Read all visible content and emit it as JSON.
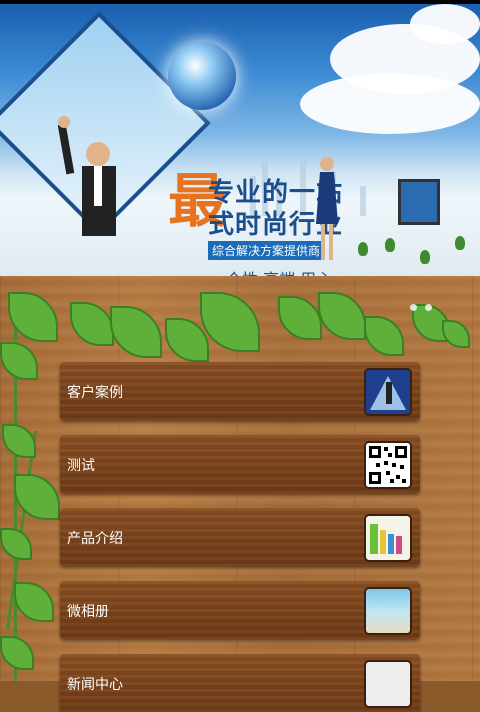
{
  "banner": {
    "big_char": "最",
    "line1": "专业的一站",
    "line2": "式时尚行业",
    "line3": "综合解决方案提供商",
    "line4": "个性 高端 用心"
  },
  "menu": {
    "items": [
      {
        "label": "客户案例",
        "icon": "case-thumb-icon"
      },
      {
        "label": "测试",
        "icon": "qr-code-icon"
      },
      {
        "label": "产品介绍",
        "icon": "product-thumb-icon"
      },
      {
        "label": "微相册",
        "icon": "album-thumb-icon"
      },
      {
        "label": "新闻中心",
        "icon": "news-thumb-icon"
      }
    ]
  },
  "colors": {
    "wood": "#b47840",
    "menu_bg": "#7a431b",
    "accent": "#e6731f",
    "brand_blue": "#1b4e8c"
  }
}
